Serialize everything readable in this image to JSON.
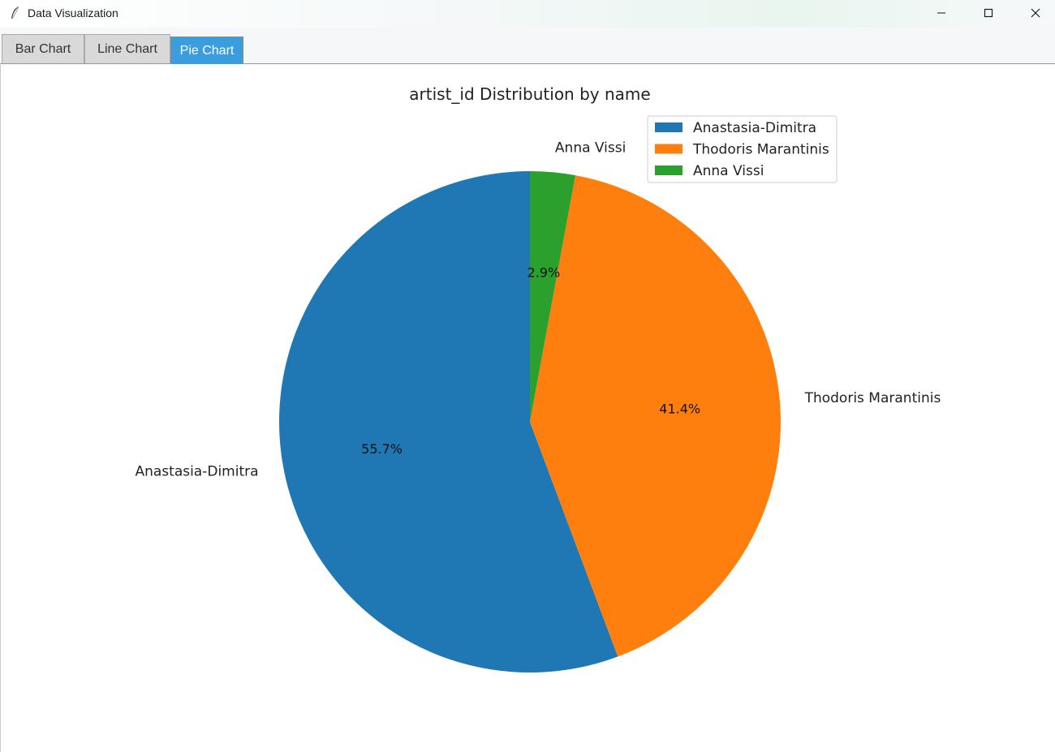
{
  "window": {
    "title": "Data Visualization",
    "icon": "feather-icon",
    "controls": [
      "minimize-icon",
      "maximize-icon",
      "close-icon"
    ]
  },
  "tabs": [
    {
      "label": "Bar Chart",
      "active": false
    },
    {
      "label": "Line Chart",
      "active": false
    },
    {
      "label": "Pie Chart",
      "active": true
    }
  ],
  "colors": {
    "active_tab": "#3a9ede",
    "slice_1": "#1f77b4",
    "slice_2": "#ff7f0e",
    "slice_3": "#2ca02c"
  },
  "chart_data": {
    "type": "pie",
    "title": "artist_id Distribution by name",
    "start_angle_deg": 90,
    "direction": "counterclockwise",
    "legend_position": "upper-right",
    "slices": [
      {
        "label": "Anastasia-Dimitra",
        "value": 55.7,
        "pct_label": "55.7%",
        "color": "#1f77b4"
      },
      {
        "label": "Thodoris Marantinis",
        "value": 41.4,
        "pct_label": "41.4%",
        "color": "#ff7f0e"
      },
      {
        "label": "Anna Vissi",
        "value": 2.9,
        "pct_label": "2.9%",
        "color": "#2ca02c"
      }
    ]
  }
}
